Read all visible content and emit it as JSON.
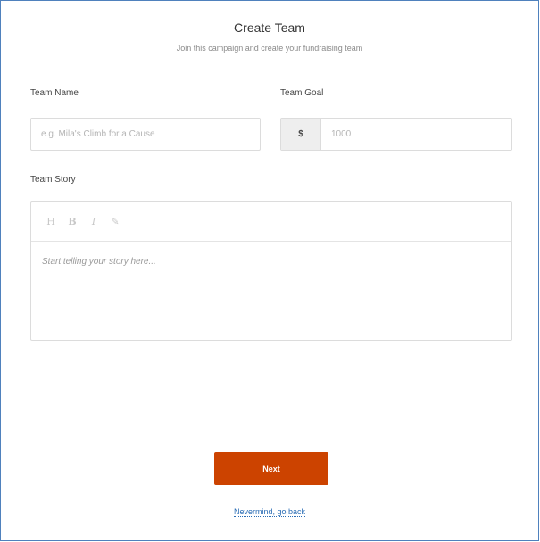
{
  "header": {
    "title": "Create Team",
    "subtitle": "Join this campaign and create your fundraising team"
  },
  "form": {
    "team_name": {
      "label": "Team Name",
      "placeholder": "e.g. Mila's Climb for a Cause",
      "value": ""
    },
    "team_goal": {
      "label": "Team Goal",
      "currency_symbol": "$",
      "placeholder": "1000",
      "value": ""
    },
    "team_story": {
      "label": "Team Story",
      "placeholder": "Start telling your story here...",
      "toolbar": {
        "heading": "H",
        "bold": "B",
        "italic": "I",
        "link": "✎"
      }
    }
  },
  "actions": {
    "next_label": "Next",
    "back_label": "Nevermind, go back"
  },
  "colors": {
    "accent": "#cc4300",
    "link": "#2a6db5",
    "frame_border": "#4f81bd"
  },
  "icons": {
    "heading": "heading-icon",
    "bold": "bold-icon",
    "italic": "italic-icon",
    "link": "link-icon"
  }
}
